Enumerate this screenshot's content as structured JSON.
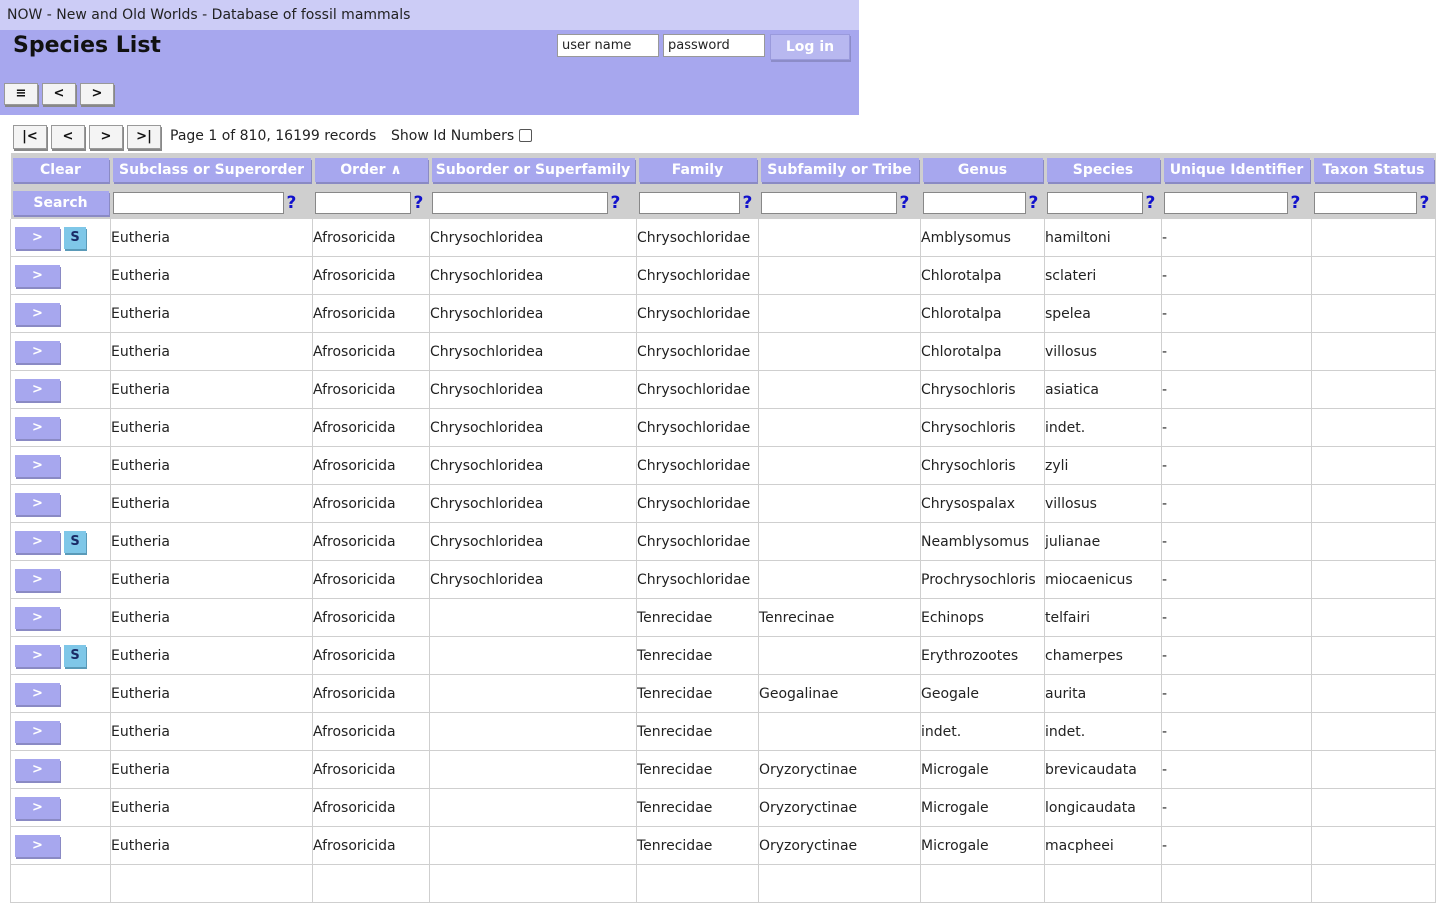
{
  "app": {
    "title": "NOW - New and Old Worlds - Database of fossil mammals",
    "page_title": "Species List"
  },
  "login": {
    "username_value": "user name",
    "password_value": "password",
    "button_label": "Log in"
  },
  "nav": {
    "menu_icon": "≡",
    "back": "<",
    "forward": ">"
  },
  "pager": {
    "first": "|<",
    "prev": "<",
    "next": ">",
    "last": ">|",
    "info": "Page 1 of 810, 16199 records",
    "show_id_label": "Show Id Numbers",
    "show_id_checked": false
  },
  "table": {
    "clear_label": "Clear",
    "search_label": "Search",
    "help_mark": "?",
    "row_open_label": ">",
    "synonym_label": "S",
    "columns": [
      "Subclass or Superorder",
      "Order ∧",
      "Suborder or Superfamily",
      "Family",
      "Subfamily or Tribe",
      "Genus",
      "Species",
      "Unique Identifier",
      "Taxon Status"
    ],
    "rows": [
      {
        "s": true,
        "cells": [
          "Eutheria",
          "Afrosoricida",
          "Chrysochloridea",
          "Chrysochloridae",
          "",
          "Amblysomus",
          "hamiltoni",
          "-",
          ""
        ]
      },
      {
        "s": false,
        "cells": [
          "Eutheria",
          "Afrosoricida",
          "Chrysochloridea",
          "Chrysochloridae",
          "",
          "Chlorotalpa",
          "sclateri",
          "-",
          ""
        ]
      },
      {
        "s": false,
        "cells": [
          "Eutheria",
          "Afrosoricida",
          "Chrysochloridea",
          "Chrysochloridae",
          "",
          "Chlorotalpa",
          "spelea",
          "-",
          ""
        ]
      },
      {
        "s": false,
        "cells": [
          "Eutheria",
          "Afrosoricida",
          "Chrysochloridea",
          "Chrysochloridae",
          "",
          "Chlorotalpa",
          "villosus",
          "-",
          ""
        ]
      },
      {
        "s": false,
        "cells": [
          "Eutheria",
          "Afrosoricida",
          "Chrysochloridea",
          "Chrysochloridae",
          "",
          "Chrysochloris",
          "asiatica",
          "-",
          ""
        ]
      },
      {
        "s": false,
        "cells": [
          "Eutheria",
          "Afrosoricida",
          "Chrysochloridea",
          "Chrysochloridae",
          "",
          "Chrysochloris",
          "indet.",
          "-",
          ""
        ]
      },
      {
        "s": false,
        "cells": [
          "Eutheria",
          "Afrosoricida",
          "Chrysochloridea",
          "Chrysochloridae",
          "",
          "Chrysochloris",
          "zyli",
          "-",
          ""
        ]
      },
      {
        "s": false,
        "cells": [
          "Eutheria",
          "Afrosoricida",
          "Chrysochloridea",
          "Chrysochloridae",
          "",
          "Chrysospalax",
          "villosus",
          "-",
          ""
        ]
      },
      {
        "s": true,
        "cells": [
          "Eutheria",
          "Afrosoricida",
          "Chrysochloridea",
          "Chrysochloridae",
          "",
          "Neamblysomus",
          "julianae",
          "-",
          ""
        ]
      },
      {
        "s": false,
        "cells": [
          "Eutheria",
          "Afrosoricida",
          "Chrysochloridea",
          "Chrysochloridae",
          "",
          "Prochrysochloris",
          "miocaenicus",
          "-",
          ""
        ]
      },
      {
        "s": false,
        "cells": [
          "Eutheria",
          "Afrosoricida",
          "",
          "Tenrecidae",
          "Tenrecinae",
          "Echinops",
          "telfairi",
          "-",
          ""
        ]
      },
      {
        "s": true,
        "cells": [
          "Eutheria",
          "Afrosoricida",
          "",
          "Tenrecidae",
          "",
          "Erythrozootes",
          "chamerpes",
          "-",
          ""
        ]
      },
      {
        "s": false,
        "cells": [
          "Eutheria",
          "Afrosoricida",
          "",
          "Tenrecidae",
          "Geogalinae",
          "Geogale",
          "aurita",
          "-",
          ""
        ]
      },
      {
        "s": false,
        "cells": [
          "Eutheria",
          "Afrosoricida",
          "",
          "Tenrecidae",
          "",
          "indet.",
          "indet.",
          "-",
          ""
        ]
      },
      {
        "s": false,
        "cells": [
          "Eutheria",
          "Afrosoricida",
          "",
          "Tenrecidae",
          "Oryzoryctinae",
          "Microgale",
          "brevicaudata",
          "-",
          ""
        ]
      },
      {
        "s": false,
        "cells": [
          "Eutheria",
          "Afrosoricida",
          "",
          "Tenrecidae",
          "Oryzoryctinae",
          "Microgale",
          "longicaudata",
          "-",
          ""
        ]
      },
      {
        "s": false,
        "cells": [
          "Eutheria",
          "Afrosoricida",
          "",
          "Tenrecidae",
          "Oryzoryctinae",
          "Microgale",
          "macpheei",
          "-",
          ""
        ]
      },
      {
        "s": false,
        "cells": [
          "",
          "",
          "",
          "",
          "",
          "",
          "",
          "",
          ""
        ]
      }
    ]
  }
}
